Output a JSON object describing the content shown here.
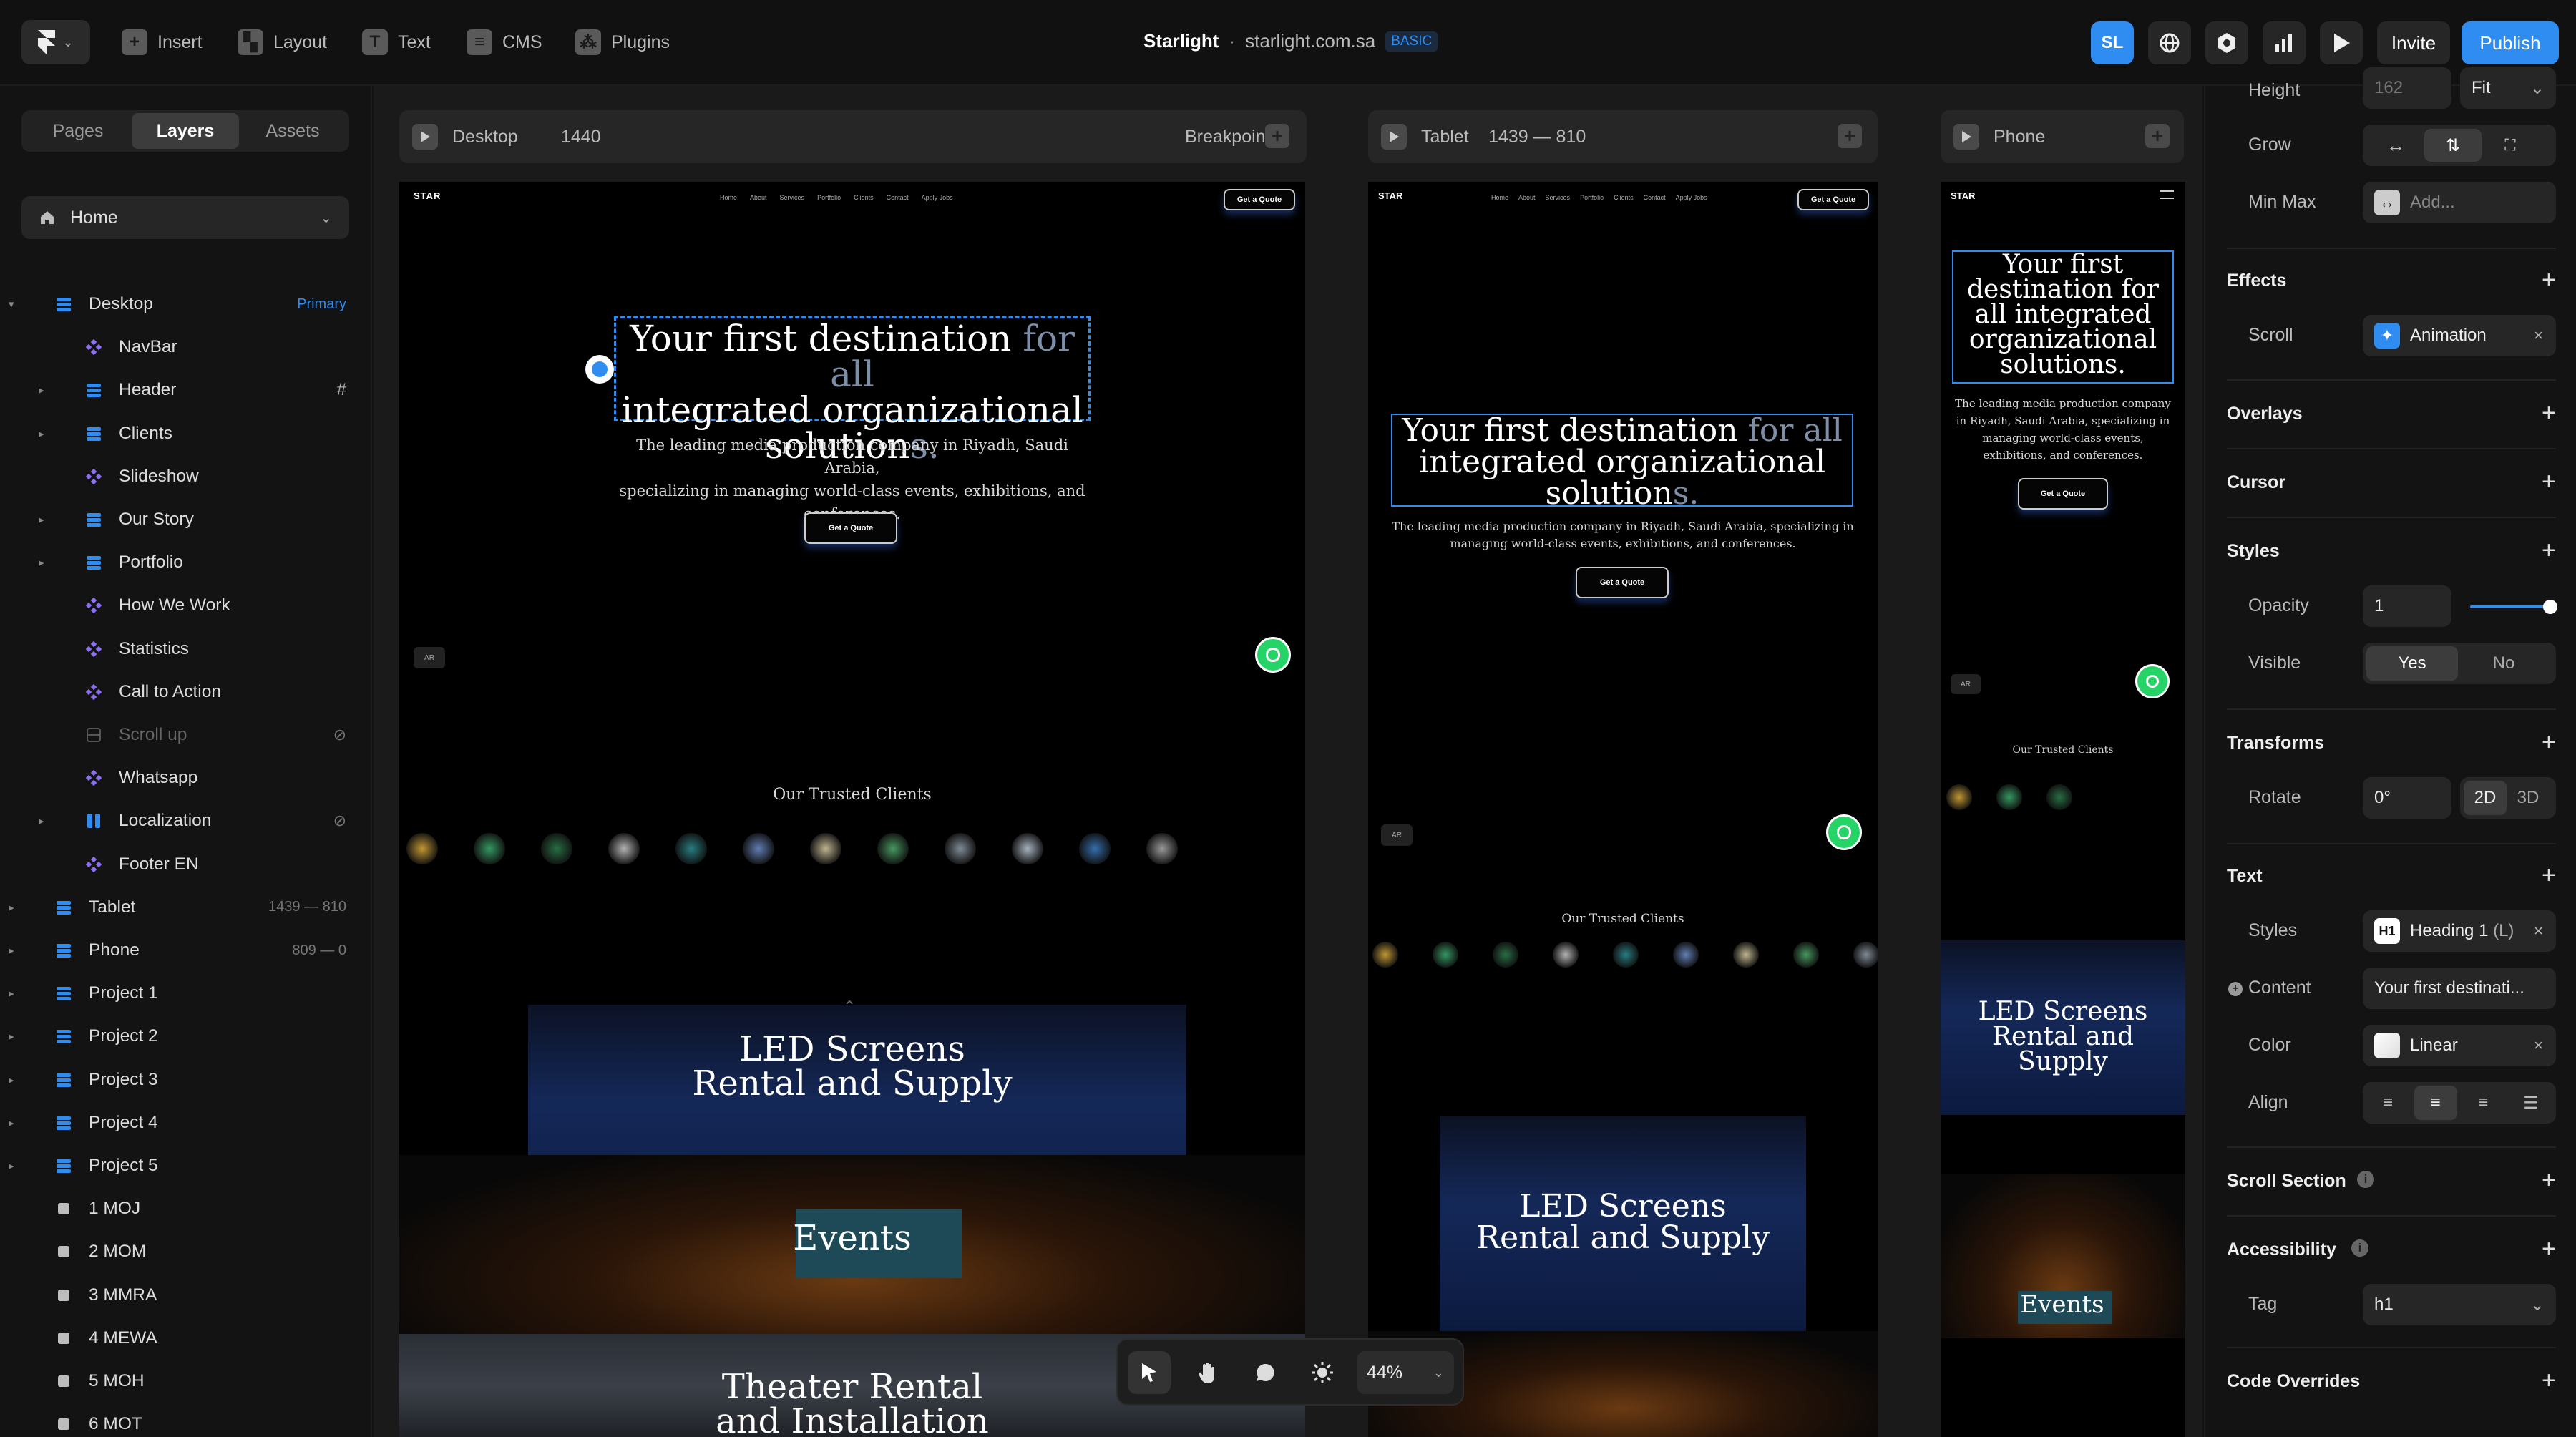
{
  "app": {
    "project_name": "Starlight",
    "domain": "starlight.com.sa",
    "plan_badge": "BASIC",
    "avatar_initials": "SL"
  },
  "toolbar": {
    "insert": "Insert",
    "layout": "Layout",
    "text": "Text",
    "cms": "CMS",
    "plugins": "Plugins",
    "invite": "Invite",
    "publish": "Publish",
    "accent": "#2f8cf0"
  },
  "left_panel": {
    "tabs": [
      "Pages",
      "Layers",
      "Assets"
    ],
    "active_tab": "Layers",
    "page": "Home",
    "layers": [
      {
        "label": "Desktop",
        "badge": "Primary",
        "kind": "frame",
        "level": 0,
        "expanded": true
      },
      {
        "label": "NavBar",
        "kind": "component",
        "level": 1
      },
      {
        "label": "Header",
        "kind": "frame",
        "level": 1,
        "collapsed": true,
        "badge": "#"
      },
      {
        "label": "Clients",
        "kind": "frame",
        "level": 1,
        "collapsed": true
      },
      {
        "label": "Slideshow",
        "kind": "component",
        "level": 1
      },
      {
        "label": "Our Story",
        "kind": "frame",
        "level": 1,
        "collapsed": true
      },
      {
        "label": "Portfolio",
        "kind": "frame",
        "level": 1,
        "collapsed": true
      },
      {
        "label": "How We Work",
        "kind": "component",
        "level": 1
      },
      {
        "label": "Statistics",
        "kind": "component",
        "level": 1
      },
      {
        "label": "Call to Action",
        "kind": "component",
        "level": 1
      },
      {
        "label": "Scroll up",
        "kind": "hidden",
        "level": 1,
        "badge": "link"
      },
      {
        "label": "Whatsapp",
        "kind": "component",
        "level": 1
      },
      {
        "label": "Localization",
        "kind": "stack",
        "level": 1,
        "collapsed": true,
        "badge": "link"
      },
      {
        "label": "Footer EN",
        "kind": "component",
        "level": 1
      },
      {
        "label": "Tablet",
        "kind": "frame",
        "level": 0,
        "collapsed": true,
        "badge": "1439 — 810"
      },
      {
        "label": "Phone",
        "kind": "frame",
        "level": 0,
        "collapsed": true,
        "badge": "809 — 0"
      },
      {
        "label": "Project 1",
        "kind": "frame",
        "level": 0,
        "collapsed": true
      },
      {
        "label": "Project 2",
        "kind": "frame",
        "level": 0,
        "collapsed": true
      },
      {
        "label": "Project 3",
        "kind": "frame",
        "level": 0,
        "collapsed": true
      },
      {
        "label": "Project 4",
        "kind": "frame",
        "level": 0,
        "collapsed": true
      },
      {
        "label": "Project 5",
        "kind": "frame",
        "level": 0,
        "collapsed": true
      },
      {
        "label": "1 MOJ",
        "kind": "page",
        "level": 0
      },
      {
        "label": "2 MOM",
        "kind": "page",
        "level": 0
      },
      {
        "label": "3 MMRA",
        "kind": "page",
        "level": 0
      },
      {
        "label": "4 MEWA",
        "kind": "page",
        "level": 0
      },
      {
        "label": "5 MOH",
        "kind": "page",
        "level": 0
      },
      {
        "label": "6 MOT",
        "kind": "page",
        "level": 0
      }
    ]
  },
  "canvas": {
    "frames": [
      {
        "name": "Desktop",
        "size": "1440",
        "extra": "Breakpoint"
      },
      {
        "name": "Tablet",
        "size": "1439 — 810"
      },
      {
        "name": "Phone",
        "size": ""
      }
    ],
    "site": {
      "logo_text": "STAR",
      "nav": [
        "Home",
        "About",
        "Services",
        "Portfolio",
        "Clients",
        "Contact",
        "Apply Jobs"
      ],
      "cta": "Get a Quote",
      "hero_lines": {
        "desktop_1a": "Your first destination",
        "desktop_1b": "for all",
        "desktop_2": "integrated organizational",
        "desktop_3a": "solution",
        "desktop_3b": "s."
      },
      "phone_hero": [
        "Your first",
        "destination for",
        "all integrated",
        "organizational",
        "solutions."
      ],
      "subtitle_desktop": [
        "The leading media production company in Riyadh, Saudi Arabia,",
        "specializing in managing world-class events, exhibitions, and",
        "conferences."
      ],
      "subtitle_tablet": [
        "The leading media production company in Riyadh, Saudi Arabia, specializing in",
        "managing world-class events, exhibitions, and conferences."
      ],
      "subtitle_phone": [
        "The leading media production company",
        "in Riyadh, Saudi Arabia, specializing in",
        "managing world-class events,",
        "exhibitions, and conferences."
      ],
      "ar_badge": "AR",
      "clients_title": "Our Trusted Clients",
      "section_led": [
        "LED Screens",
        "Rental and Supply"
      ],
      "section_led_phone": [
        "LED Screens",
        "Rental and",
        "Supply"
      ],
      "section_events": "Events",
      "section_theater": [
        "Theater Rental",
        "and Installation"
      ]
    },
    "zoom": "44%"
  },
  "right_panel": {
    "height_label": "Height",
    "height_value": "162",
    "height_mode": "Fit",
    "grow_label": "Grow",
    "minmax_label": "Min Max",
    "minmax_placeholder": "Add...",
    "effects": "Effects",
    "scroll_label": "Scroll",
    "scroll_value": "Animation",
    "overlays": "Overlays",
    "cursor": "Cursor",
    "styles": "Styles",
    "opacity_label": "Opacity",
    "opacity_value": "1",
    "opacity_fraction": 1.0,
    "visible_label": "Visible",
    "visible_yes": "Yes",
    "visible_no": "No",
    "transforms": "Transforms",
    "rotate_label": "Rotate",
    "rotate_value": "0°",
    "mode_2d": "2D",
    "mode_3d": "3D",
    "text": "Text",
    "text_styles_label": "Styles",
    "text_style_badge": "H1",
    "text_style_value": "Heading 1",
    "text_style_suffix": "(L)",
    "content_label": "Content",
    "content_value": "Your first destinati...",
    "color_label": "Color",
    "color_value": "Linear",
    "align_label": "Align",
    "scroll_section": "Scroll Section",
    "accessibility": "Accessibility",
    "tag_label": "Tag",
    "tag_value": "h1",
    "code_overrides": "Code Overrides"
  }
}
